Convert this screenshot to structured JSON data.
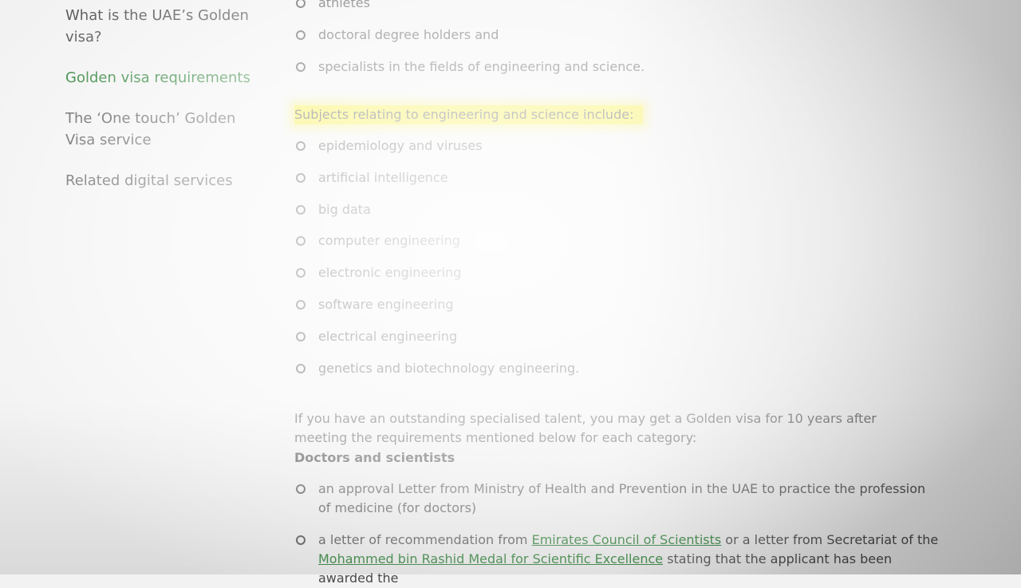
{
  "sidebar": {
    "items": [
      {
        "label": "What is the UAE’s Golden visa?"
      },
      {
        "label": "Golden visa requirements"
      },
      {
        "label": "The ‘One touch’ Golden Visa service"
      },
      {
        "label": "Related digital services"
      }
    ]
  },
  "main": {
    "top_list": [
      "athletes",
      "doctoral degree holders and",
      "specialists in the fields of engineering and science."
    ],
    "subjects_heading": "Subjects relating to engineering and science include:",
    "subjects": [
      "epidemiology and viruses",
      "artificial intelligence",
      "big data",
      "computer engineering",
      "electronic engineering",
      "software engineering",
      "electrical engineering",
      "genetics and biotechnology engineering."
    ],
    "intro": "If you have an outstanding specialised talent, you may get a Golden visa for 10 years after meeting the requirements mentioned below for each category:",
    "category_title": "Doctors and scientists",
    "requirements": {
      "item1": "an approval Letter from Ministry of Health and Prevention in the UAE to practice the profession of medicine (for doctors)",
      "item2_prefix": "a letter of recommendation from ",
      "item2_link1": "Emirates Council of Scientists",
      "item2_mid": " or a letter from Secretariat of the ",
      "item2_link2": "Mohammed bin Rashid Medal for Scientific Excellence",
      "item2_suffix": " stating that the applicant has been awarded the"
    }
  },
  "colors": {
    "accent_green": "#1f7a2a",
    "highlight_yellow": "#f7ef3a"
  }
}
